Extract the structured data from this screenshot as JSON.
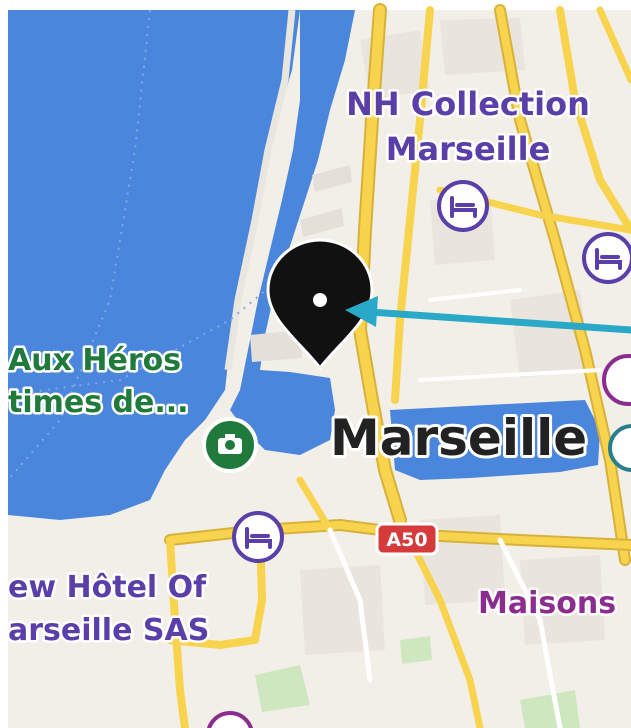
{
  "map": {
    "poi_labels": {
      "hotel_top_line1": "NH Collection",
      "hotel_top_line2": "Marseille",
      "monument_line1": "Aux Héros",
      "monument_line2": "times de...",
      "hotel_bottom_line1": "ew Hôtel Of",
      "hotel_bottom_line2": "arseille SAS",
      "maisons": "Maisons"
    },
    "city_label": "Marseille",
    "road_shield": "A50",
    "icons": [
      "hotel-icon",
      "camera-icon",
      "location-pin-icon",
      "arrow-icon"
    ],
    "colors": {
      "water": "#4a86dc",
      "land": "#f2efe8",
      "road_major": "#f8d34d",
      "hotel_label": "#5a3fa8",
      "monument_label": "#1f7a3c",
      "shield": "#d63b3b",
      "arrow": "#29a8c8",
      "pin": "#111111"
    }
  }
}
